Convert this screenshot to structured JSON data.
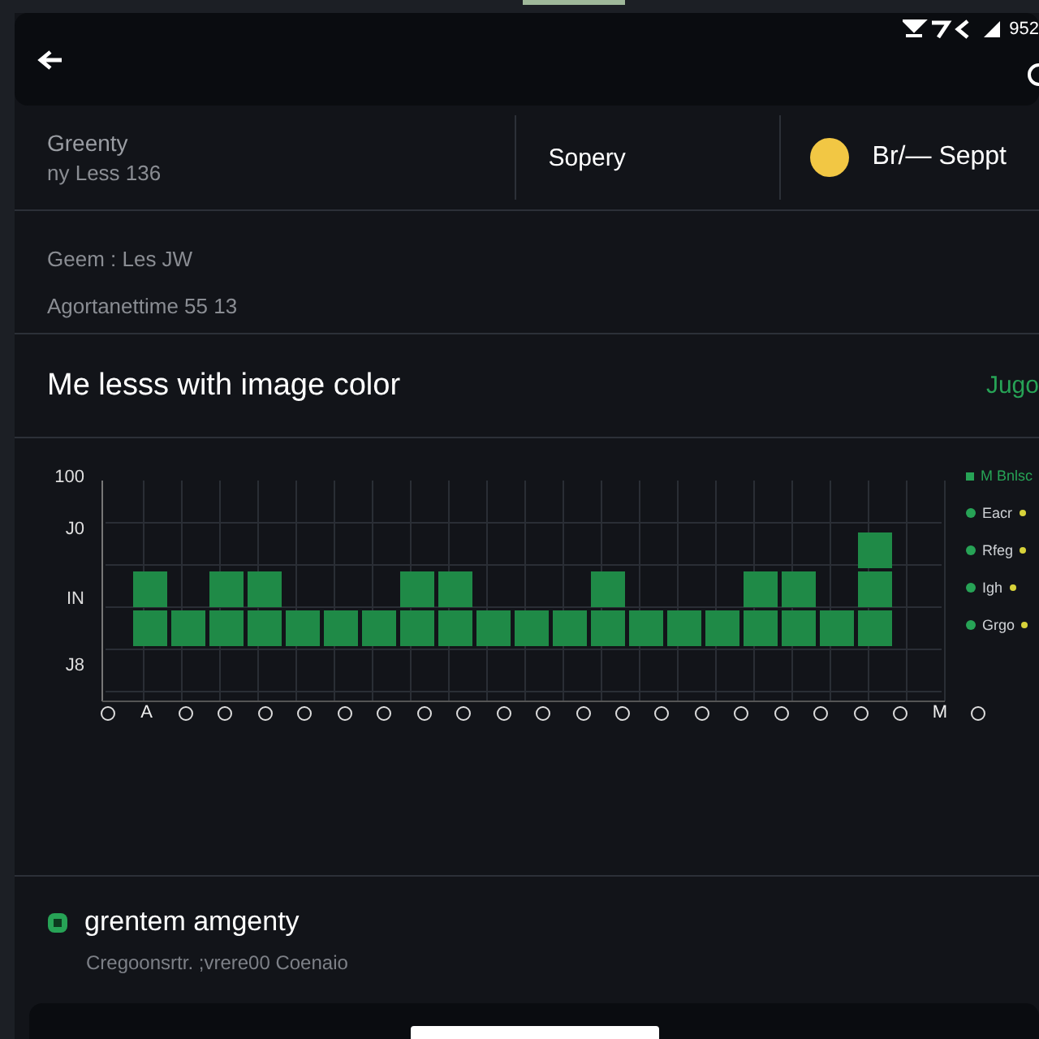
{
  "status_bar": {
    "time": "952"
  },
  "summary": [
    {
      "kind": "double",
      "title": "Greenty",
      "subtitle": "ny Less 136"
    },
    {
      "kind": "single",
      "title": "Sopery"
    },
    {
      "kind": "dot",
      "title": "Br/— Seppt",
      "color": "#f2c744"
    }
  ],
  "details": {
    "line_1": "Geem : Les JW",
    "line_2": "Agortanettime 55 13"
  },
  "chart_card": {
    "title": "Me lesss with image color",
    "action": "Jugo",
    "y_tick_labels": [
      "100",
      "J0",
      "IN",
      "J8"
    ],
    "x_markers": [
      {
        "kind": "circle"
      },
      {
        "kind": "text",
        "text": "A"
      },
      {
        "kind": "circle"
      },
      {
        "kind": "circle"
      },
      {
        "kind": "circle"
      },
      {
        "kind": "circle"
      },
      {
        "kind": "circle"
      },
      {
        "kind": "circle"
      },
      {
        "kind": "circle"
      },
      {
        "kind": "circle"
      },
      {
        "kind": "circle"
      },
      {
        "kind": "circle"
      },
      {
        "kind": "circle"
      },
      {
        "kind": "circle"
      },
      {
        "kind": "circle"
      },
      {
        "kind": "circle"
      },
      {
        "kind": "circle"
      },
      {
        "kind": "circle"
      },
      {
        "kind": "circle"
      },
      {
        "kind": "circle"
      },
      {
        "kind": "circle"
      },
      {
        "kind": "text",
        "text": "M"
      },
      {
        "kind": "circle"
      }
    ],
    "legend_title": "M Bnlsc",
    "legend": [
      "Eacr",
      "Rfeg",
      "Igh",
      "Grgo"
    ]
  },
  "footer_item": {
    "title": "grentem amgenty",
    "subtitle": "Cregoonsrtr. ;vrere00 Coenaio"
  }
}
